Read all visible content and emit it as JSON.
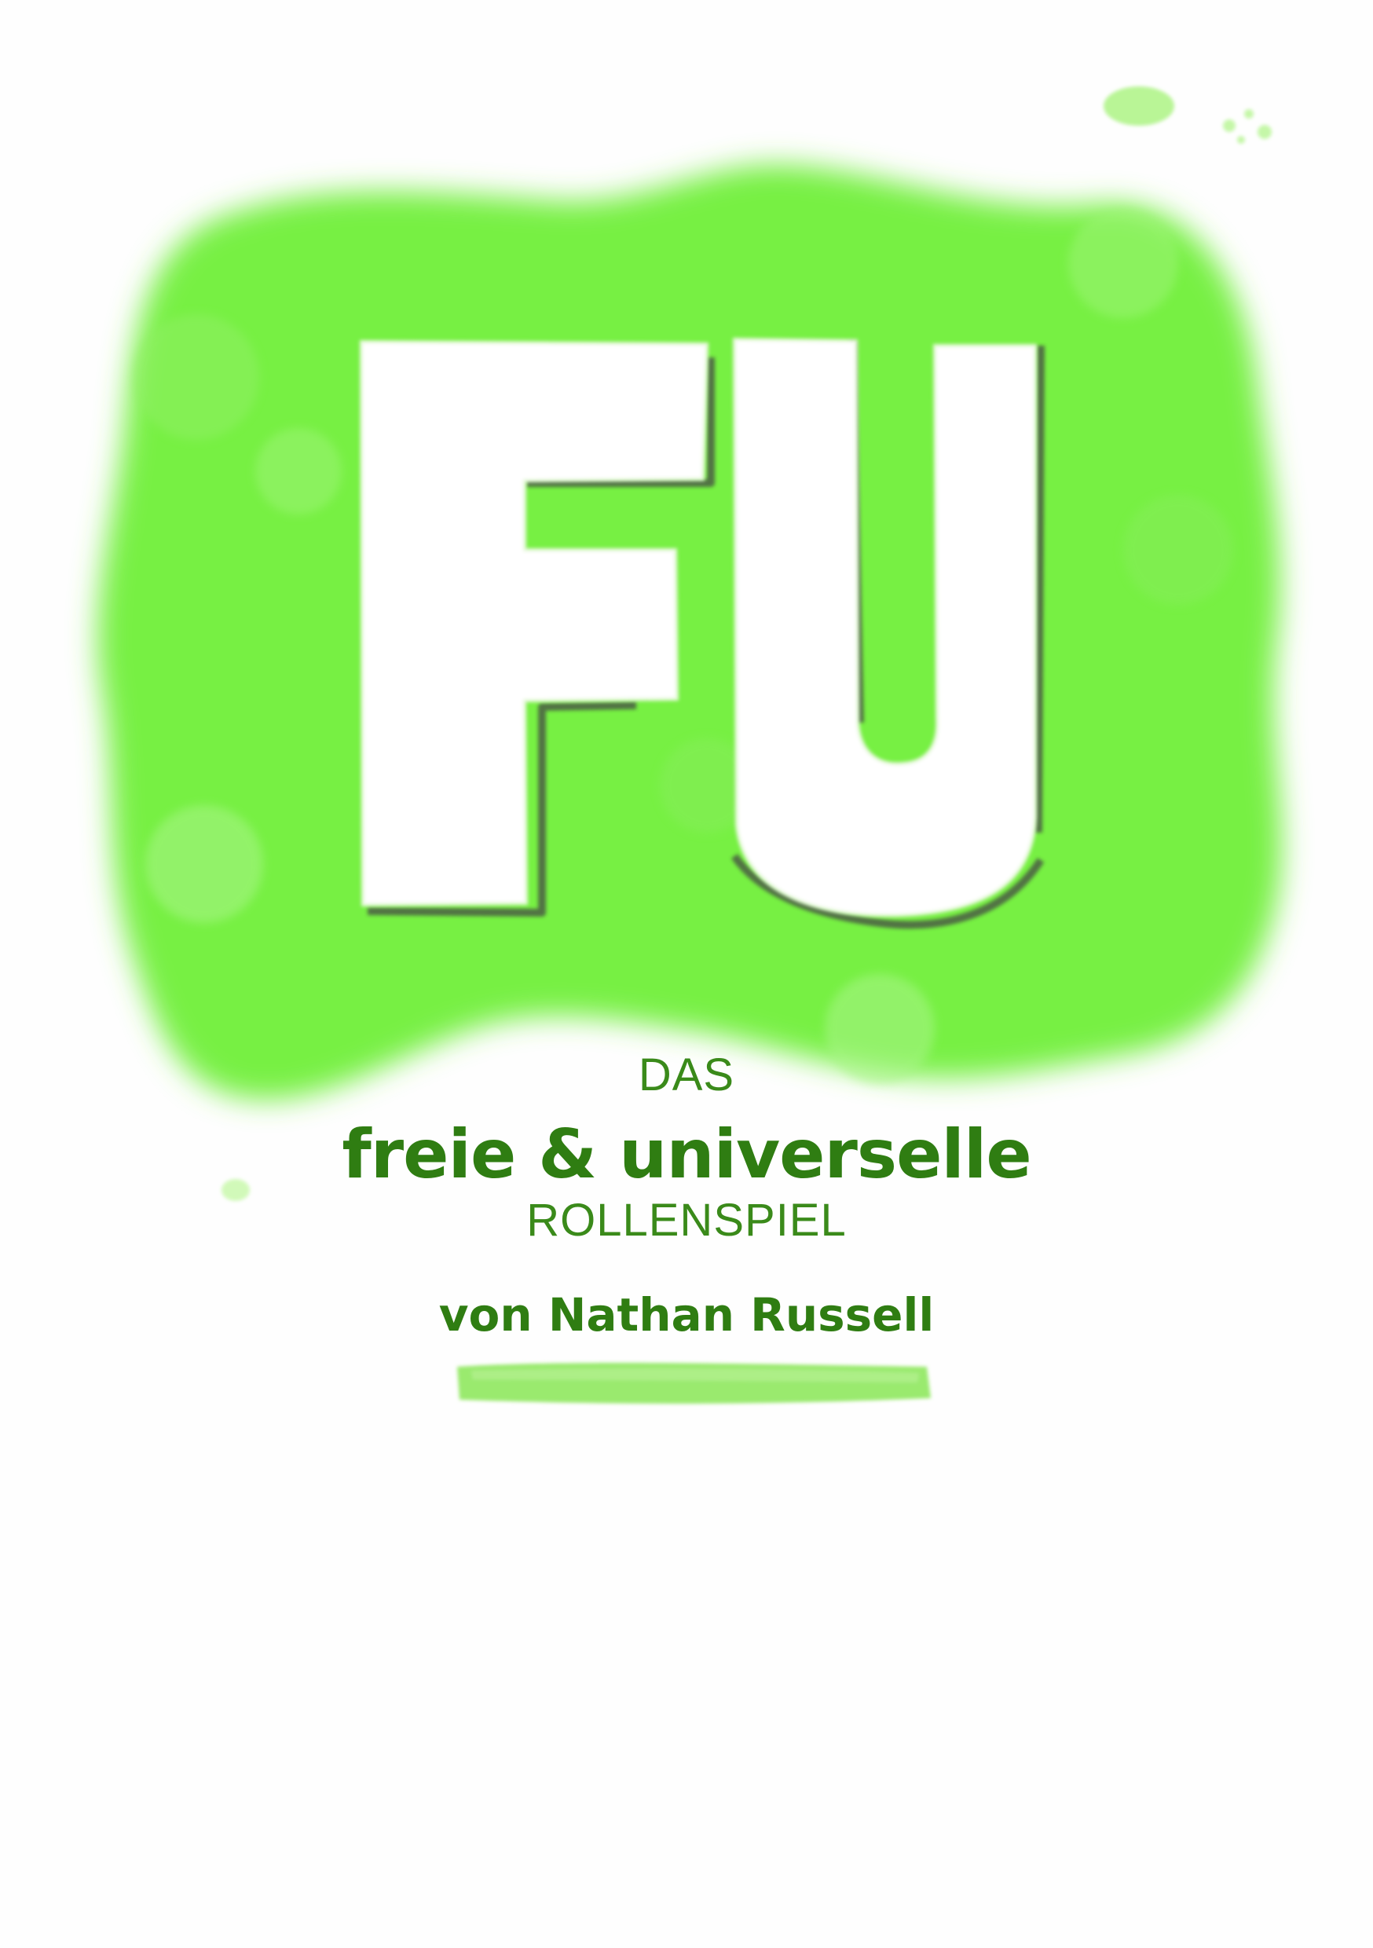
{
  "cover": {
    "logo_text": "FU",
    "kicker": "DAS",
    "headline": "freie & universelle",
    "subline": "ROLLENSPIEL",
    "author": "von Nathan Russell"
  },
  "colors": {
    "background": "#fefefe",
    "splash_green": "#6ff03a",
    "text_green": "#2f7d12",
    "outline_dark": "#3c5a32"
  }
}
